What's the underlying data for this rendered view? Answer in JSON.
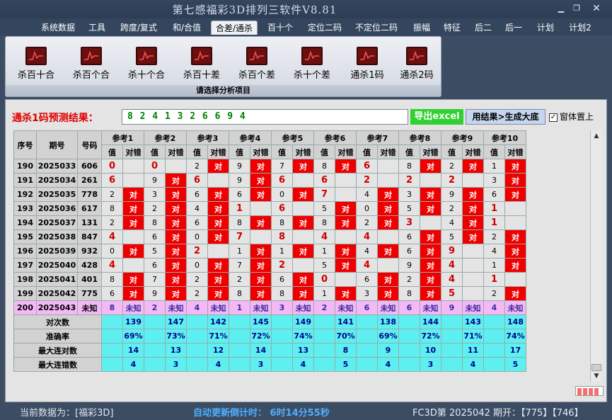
{
  "app": {
    "title": "第七感福彩3D排列三软件V8.81"
  },
  "menu": [
    "系统数据",
    "工具",
    "跨度/复式",
    "和/合值",
    "合差/通杀",
    "百十个",
    "定位二码",
    "不定位二码",
    "振幅",
    "特征",
    "后二",
    "后一",
    "计划",
    "计划2"
  ],
  "tools": [
    "杀百十合",
    "杀百个合",
    "杀十个合",
    "杀百十差",
    "杀百个差",
    "杀十个差",
    "通杀1码",
    "通杀2码"
  ],
  "panel_footer": "请选择分析项目",
  "prediction": {
    "label": "通杀1码预测结果：",
    "value": "8 2 4 1 3 2 6 6 9 4"
  },
  "buttons": {
    "export": "导出excel",
    "apply": "用结果>生成大底"
  },
  "topmost": {
    "label": "窗体置上",
    "checked": true
  },
  "table": {
    "headers": {
      "seq": "序号",
      "period": "期号",
      "code": "号码",
      "value": "值",
      "result": "对错"
    },
    "refs": [
      "参考1",
      "参考2",
      "参考3",
      "参考4",
      "参考5",
      "参考6",
      "参考7",
      "参考8",
      "参考9",
      "参考10"
    ],
    "rows": [
      {
        "seq": "190",
        "period": "2025033",
        "code": "606",
        "cells": [
          [
            "0",
            ""
          ],
          [
            "0",
            ""
          ],
          [
            "2",
            "对"
          ],
          [
            "9",
            "对"
          ],
          [
            "7",
            "对"
          ],
          [
            "8",
            "对"
          ],
          [
            "6",
            ""
          ],
          [
            "8",
            "对"
          ],
          [
            "2",
            "对"
          ],
          [
            "1",
            "对"
          ]
        ]
      },
      {
        "seq": "191",
        "period": "2025034",
        "code": "261",
        "cells": [
          [
            "6",
            ""
          ],
          [
            "9",
            "对"
          ],
          [
            "6",
            ""
          ],
          [
            "9",
            "对"
          ],
          [
            "6",
            ""
          ],
          [
            "6",
            ""
          ],
          [
            "2",
            ""
          ],
          [
            "2",
            ""
          ],
          [
            "2",
            ""
          ],
          [
            "3",
            "对"
          ]
        ]
      },
      {
        "seq": "192",
        "period": "2025035",
        "code": "778",
        "cells": [
          [
            "2",
            "对"
          ],
          [
            "3",
            "对"
          ],
          [
            "6",
            "对"
          ],
          [
            "6",
            "对"
          ],
          [
            "0",
            "对"
          ],
          [
            "7",
            ""
          ],
          [
            "4",
            "对"
          ],
          [
            "3",
            "对"
          ],
          [
            "9",
            "对"
          ],
          [
            "6",
            "对"
          ]
        ]
      },
      {
        "seq": "193",
        "period": "2025036",
        "code": "617",
        "cells": [
          [
            "8",
            "对"
          ],
          [
            "2",
            "对"
          ],
          [
            "4",
            "对"
          ],
          [
            "1",
            ""
          ],
          [
            "6",
            ""
          ],
          [
            "5",
            "对"
          ],
          [
            "0",
            "对"
          ],
          [
            "5",
            "对"
          ],
          [
            "2",
            "对"
          ],
          [
            "1",
            ""
          ]
        ]
      },
      {
        "seq": "194",
        "period": "2025037",
        "code": "131",
        "cells": [
          [
            "2",
            "对"
          ],
          [
            "8",
            "对"
          ],
          [
            "6",
            "对"
          ],
          [
            "8",
            "对"
          ],
          [
            "8",
            "对"
          ],
          [
            "8",
            "对"
          ],
          [
            "2",
            "对"
          ],
          [
            "3",
            ""
          ],
          [
            "4",
            "对"
          ],
          [
            "1",
            ""
          ]
        ]
      },
      {
        "seq": "195",
        "period": "2025038",
        "code": "847",
        "cells": [
          [
            "4",
            ""
          ],
          [
            "6",
            "对"
          ],
          [
            "0",
            "对"
          ],
          [
            "7",
            ""
          ],
          [
            "8",
            ""
          ],
          [
            "4",
            ""
          ],
          [
            "4",
            ""
          ],
          [
            "6",
            "对"
          ],
          [
            "5",
            "对"
          ],
          [
            "2",
            "对"
          ]
        ]
      },
      {
        "seq": "196",
        "period": "2025039",
        "code": "932",
        "cells": [
          [
            "0",
            "对"
          ],
          [
            "5",
            "对"
          ],
          [
            "2",
            ""
          ],
          [
            "1",
            "对"
          ],
          [
            "1",
            "对"
          ],
          [
            "1",
            "对"
          ],
          [
            "4",
            "对"
          ],
          [
            "6",
            "对"
          ],
          [
            "9",
            ""
          ],
          [
            "4",
            "对"
          ]
        ]
      },
      {
        "seq": "197",
        "period": "2025040",
        "code": "428",
        "cells": [
          [
            "4",
            ""
          ],
          [
            "6",
            "对"
          ],
          [
            "0",
            "对"
          ],
          [
            "7",
            "对"
          ],
          [
            "2",
            ""
          ],
          [
            "5",
            "对"
          ],
          [
            "4",
            ""
          ],
          [
            "9",
            "对"
          ],
          [
            "4",
            ""
          ],
          [
            "1",
            "对"
          ]
        ]
      },
      {
        "seq": "198",
        "period": "2025041",
        "code": "401",
        "cells": [
          [
            "8",
            "对"
          ],
          [
            "7",
            "对"
          ],
          [
            "2",
            "对"
          ],
          [
            "2",
            "对"
          ],
          [
            "6",
            "对"
          ],
          [
            "0",
            ""
          ],
          [
            "6",
            "对"
          ],
          [
            "2",
            "对"
          ],
          [
            "4",
            ""
          ],
          [
            "1",
            ""
          ]
        ]
      },
      {
        "seq": "199",
        "period": "2025042",
        "code": "775",
        "cells": [
          [
            "6",
            "对"
          ],
          [
            "9",
            "对"
          ],
          [
            "2",
            "对"
          ],
          [
            "8",
            "对"
          ],
          [
            "8",
            "对"
          ],
          [
            "1",
            "对"
          ],
          [
            "3",
            "对"
          ],
          [
            "8",
            "对"
          ],
          [
            "5",
            ""
          ],
          [
            "2",
            "对"
          ]
        ]
      }
    ],
    "pending": {
      "seq": "200",
      "period": "2025043",
      "code": "未知",
      "values": [
        "8",
        "2",
        "4",
        "1",
        "3",
        "2",
        "6",
        "6",
        "9",
        "4"
      ],
      "result": "未知"
    },
    "stats": [
      {
        "label": "对次数",
        "values": [
          "139",
          "147",
          "142",
          "145",
          "149",
          "141",
          "138",
          "144",
          "143",
          "148"
        ]
      },
      {
        "label": "准确率",
        "values": [
          "69%",
          "73%",
          "71%",
          "72%",
          "74%",
          "70%",
          "69%",
          "72%",
          "71%",
          "74%"
        ]
      },
      {
        "label": "最大连对数",
        "values": [
          "14",
          "13",
          "12",
          "14",
          "13",
          "8",
          "9",
          "10",
          "11",
          "17"
        ]
      },
      {
        "label": "最大连错数",
        "values": [
          "4",
          "3",
          "4",
          "3",
          "4",
          "5",
          "4",
          "3",
          "4",
          "5"
        ]
      }
    ]
  },
  "status": {
    "left": "当前数据为：[福彩3D]",
    "countdown": "自动更新倒计时： 6时14分55秒",
    "right": "FC3D第 2025042 期开：【775】【746】"
  },
  "colors": {
    "hit": "#ee0000",
    "pending": "#f4b9f4",
    "stats": "#5ef0f0",
    "export": "#2fd02f",
    "title": "#d6dce8"
  }
}
